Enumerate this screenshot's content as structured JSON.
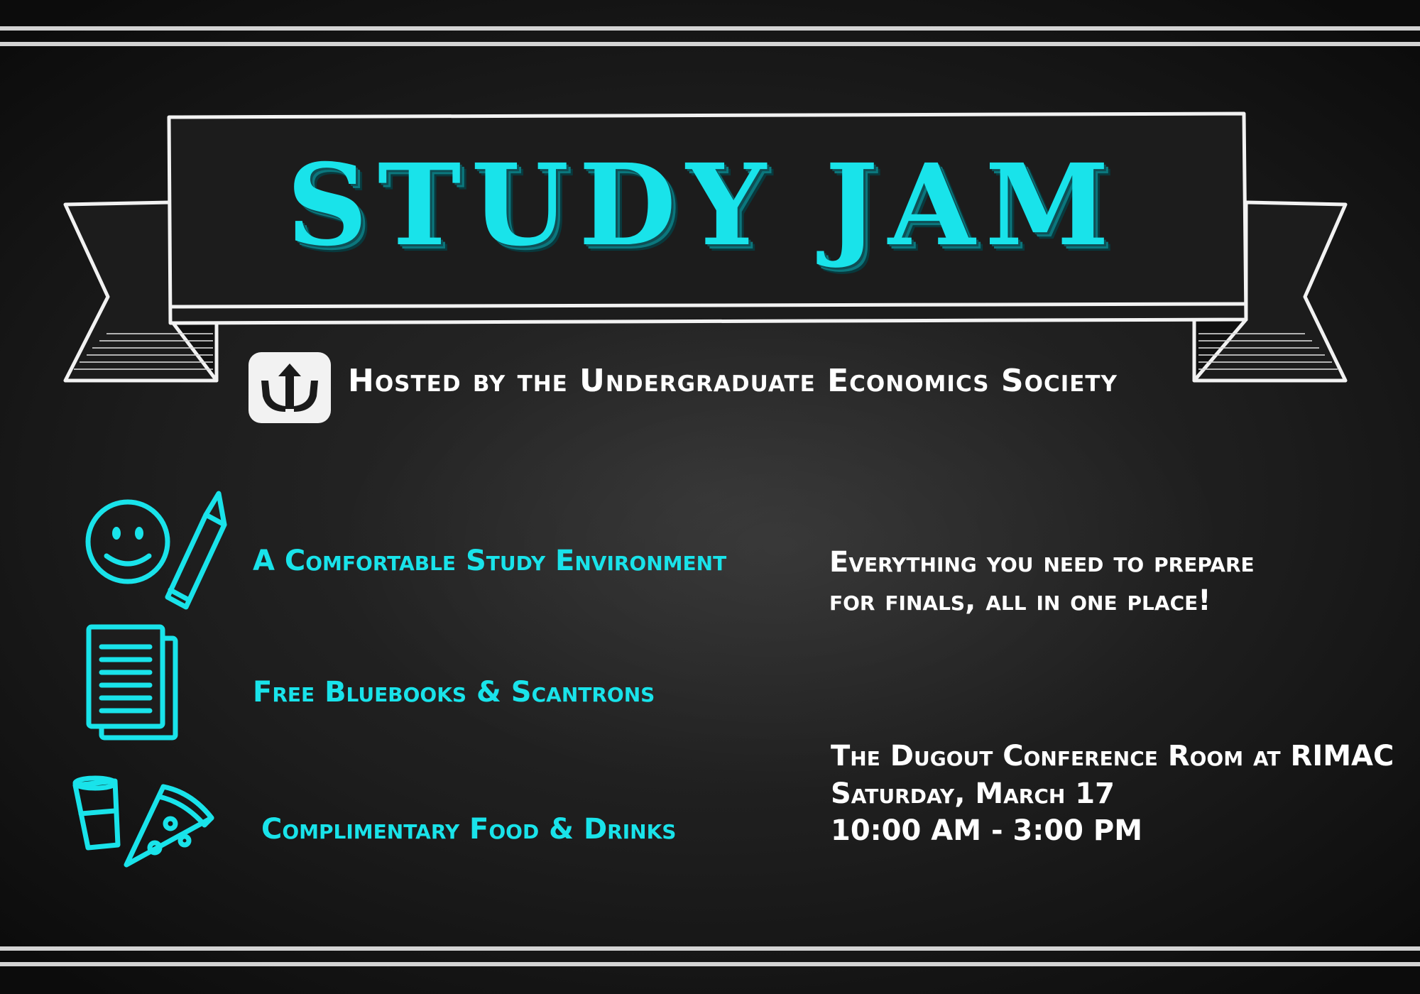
{
  "title": "STUDY JAM",
  "host_line": "Hosted by the Undergraduate Economics Society",
  "features": [
    "A Comfortable Study Environment",
    "Free Bluebooks & Scantrons",
    "Complimentary Food & Drinks"
  ],
  "tagline": [
    "Everything you need to prepare",
    "for finals, all in one place!"
  ],
  "event": {
    "location": "The Dugout Conference Room at RIMAC",
    "date": "Saturday, March 17",
    "time": "10:00 AM - 3:00 PM"
  },
  "icons": [
    "smiley-icon",
    "pencil-icon",
    "papers-icon",
    "cup-icon",
    "pizza-icon",
    "trident-logo-icon"
  ],
  "colors": {
    "accent": "#19e3ea",
    "text": "#ffffff",
    "background": "#1d1d1d"
  }
}
